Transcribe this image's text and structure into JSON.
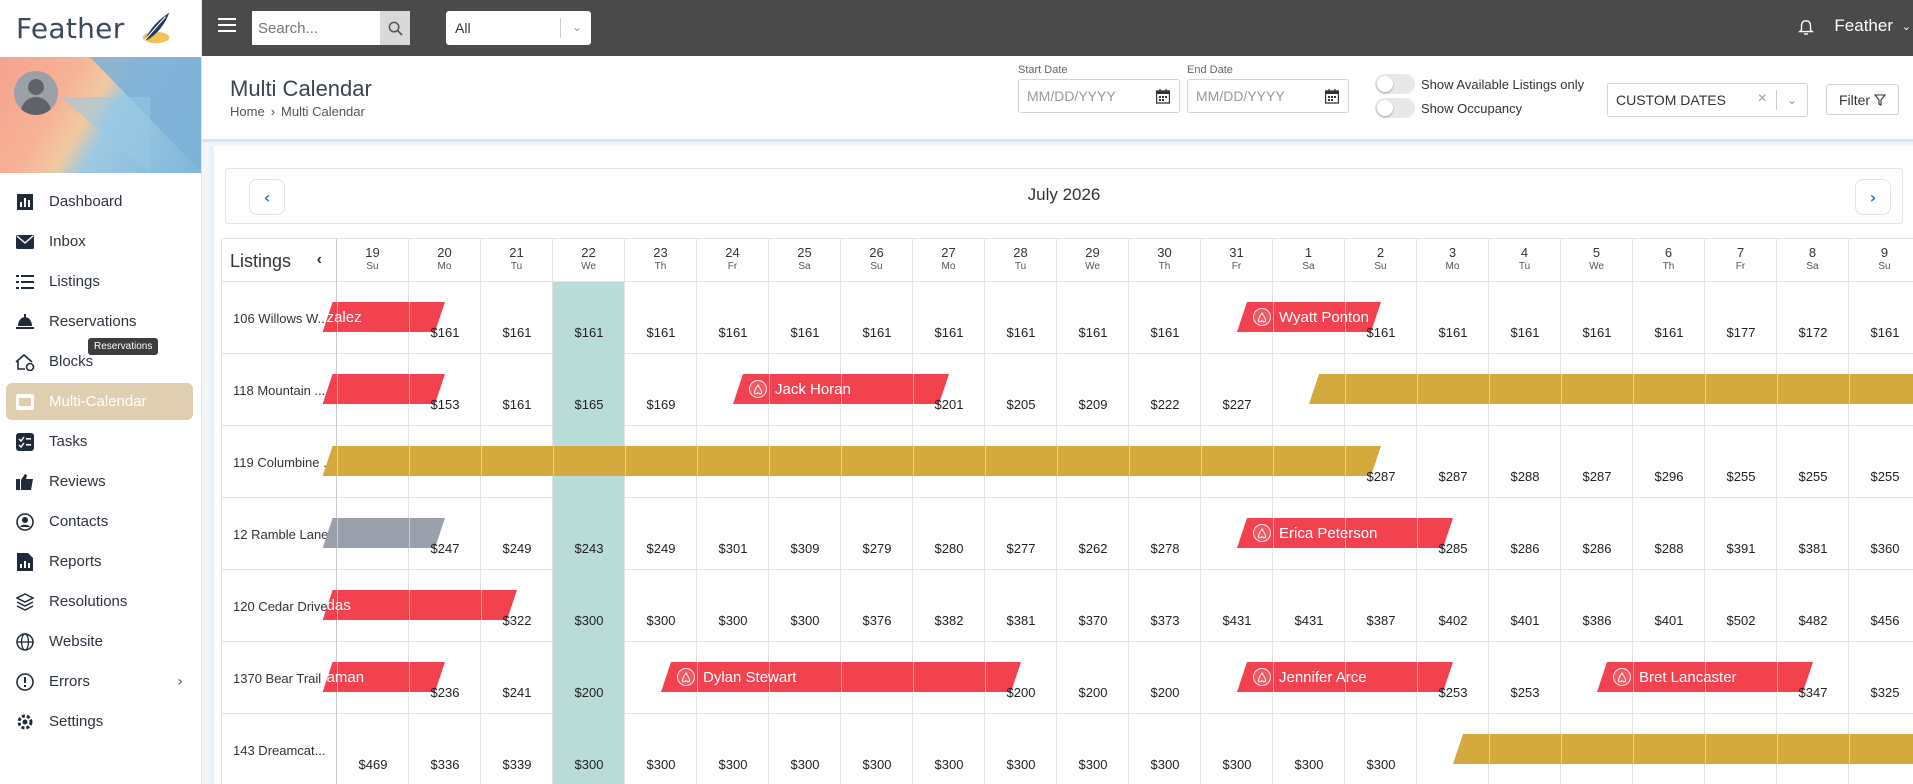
{
  "brand": {
    "name": "Feather"
  },
  "sidebar": {
    "items": [
      {
        "key": "dashboard",
        "label": "Dashboard",
        "icon": "bar-chart-icon"
      },
      {
        "key": "inbox",
        "label": "Inbox",
        "icon": "mail-icon"
      },
      {
        "key": "listings",
        "label": "Listings",
        "icon": "list-icon"
      },
      {
        "key": "reservations",
        "label": "Reservations",
        "icon": "bell-service-icon"
      },
      {
        "key": "blocks",
        "label": "Blocks",
        "icon": "home-lock-icon"
      },
      {
        "key": "multi-calendar",
        "label": "Multi-Calendar",
        "icon": "calendar-icon",
        "active": true
      },
      {
        "key": "tasks",
        "label": "Tasks",
        "icon": "checklist-icon"
      },
      {
        "key": "reviews",
        "label": "Reviews",
        "icon": "reviews-icon"
      },
      {
        "key": "contacts",
        "label": "Contacts",
        "icon": "contact-icon"
      },
      {
        "key": "reports",
        "label": "Reports",
        "icon": "report-icon"
      },
      {
        "key": "resolutions",
        "label": "Resolutions",
        "icon": "layers-icon"
      },
      {
        "key": "website",
        "label": "Website",
        "icon": "globe-icon"
      },
      {
        "key": "errors",
        "label": "Errors",
        "icon": "alert-circle-icon",
        "has_chevron": true
      },
      {
        "key": "settings",
        "label": "Settings",
        "icon": "gear-icon"
      }
    ],
    "tooltip": "Reservations"
  },
  "topbar": {
    "search_placeholder": "Search...",
    "filter_value": "All",
    "user_name": "Feather"
  },
  "header": {
    "title": "Multi Calendar",
    "breadcrumb": [
      "Home",
      "Multi Calendar"
    ],
    "start_date_label": "Start Date",
    "end_date_label": "End Date",
    "date_placeholder": "MM/DD/YYYY",
    "toggle_available": "Show Available Listings only",
    "toggle_occupancy": "Show Occupancy",
    "date_range_value": "CUSTOM DATES",
    "filter_label": "Filter"
  },
  "calendar": {
    "month_label": "July 2026",
    "listings_label": "Listings",
    "days": [
      {
        "num": "19",
        "dow": "Su"
      },
      {
        "num": "20",
        "dow": "Mo"
      },
      {
        "num": "21",
        "dow": "Tu"
      },
      {
        "num": "22",
        "dow": "We",
        "today": true
      },
      {
        "num": "23",
        "dow": "Th"
      },
      {
        "num": "24",
        "dow": "Fr"
      },
      {
        "num": "25",
        "dow": "Sa"
      },
      {
        "num": "26",
        "dow": "Su"
      },
      {
        "num": "27",
        "dow": "Mo"
      },
      {
        "num": "28",
        "dow": "Tu"
      },
      {
        "num": "29",
        "dow": "We"
      },
      {
        "num": "30",
        "dow": "Th"
      },
      {
        "num": "31",
        "dow": "Fr"
      },
      {
        "num": "1",
        "dow": "Sa"
      },
      {
        "num": "2",
        "dow": "Su"
      },
      {
        "num": "3",
        "dow": "Mo"
      },
      {
        "num": "4",
        "dow": "Tu"
      },
      {
        "num": "5",
        "dow": "We"
      },
      {
        "num": "6",
        "dow": "Th"
      },
      {
        "num": "7",
        "dow": "Fr"
      },
      {
        "num": "8",
        "dow": "Sa"
      },
      {
        "num": "9",
        "dow": "Su"
      }
    ],
    "colors": {
      "booking": "#f2424f",
      "owner_block": "#d4a93e",
      "blocked": "#9aa0ab",
      "today": "#b9dcd9"
    },
    "rows": [
      {
        "name": "106 Willows W...",
        "prices": [
          "",
          "$161",
          "$161",
          "$161",
          "$161",
          "$161",
          "$161",
          "$161",
          "$161",
          "$161",
          "$161",
          "$161",
          "",
          "",
          "$161",
          "$161",
          "$161",
          "$161",
          "$161",
          "$177",
          "$172",
          "$161"
        ],
        "bars": [
          {
            "start": -0.2,
            "end": 1.5,
            "color": "booking",
            "label": "zalez",
            "icon": false
          },
          {
            "start": 12.5,
            "end": 14.5,
            "color": "booking",
            "label": "Wyatt Ponton",
            "icon": true
          }
        ]
      },
      {
        "name": "118 Mountain ...",
        "prices": [
          "",
          "$153",
          "$161",
          "$165",
          "$169",
          "",
          "",
          "",
          "$201",
          "$205",
          "$209",
          "$222",
          "$227",
          "",
          "",
          "",
          "",
          "",
          "",
          "",
          "",
          ""
        ],
        "bars": [
          {
            "start": -0.2,
            "end": 1.5,
            "color": "booking",
            "label": "",
            "icon": false
          },
          {
            "start": 5.5,
            "end": 8.5,
            "color": "booking",
            "label": "Jack Horan",
            "icon": true
          },
          {
            "start": 13.5,
            "end": 22.5,
            "color": "owner_block",
            "label": "",
            "icon": false
          }
        ]
      },
      {
        "name": "119 Columbine ...",
        "prices": [
          "",
          "",
          "",
          "",
          "",
          "",
          "",
          "",
          "",
          "",
          "",
          "",
          "",
          "",
          "$287",
          "$287",
          "$288",
          "$287",
          "$296",
          "$255",
          "$255",
          "$255"
        ],
        "bars": [
          {
            "start": -0.2,
            "end": 14.5,
            "color": "owner_block",
            "label": "",
            "icon": false
          }
        ]
      },
      {
        "name": "12 Ramble Lane",
        "prices": [
          "",
          "$247",
          "$249",
          "$243",
          "$249",
          "$301",
          "$309",
          "$279",
          "$280",
          "$277",
          "$262",
          "$278",
          "",
          "",
          "",
          "$285",
          "$286",
          "$286",
          "$288",
          "$391",
          "$381",
          "$360"
        ],
        "bars": [
          {
            "start": -0.2,
            "end": 1.5,
            "color": "blocked",
            "label": "",
            "icon": false
          },
          {
            "start": 12.5,
            "end": 15.5,
            "color": "booking",
            "label": "Erica Peterson",
            "icon": true
          }
        ]
      },
      {
        "name": "120 Cedar Drive",
        "prices": [
          "",
          "",
          "$322",
          "$300",
          "$300",
          "$300",
          "$300",
          "$376",
          "$382",
          "$381",
          "$370",
          "$373",
          "$431",
          "$431",
          "$387",
          "$402",
          "$401",
          "$386",
          "$401",
          "$502",
          "$482",
          "$456"
        ],
        "bars": [
          {
            "start": -0.2,
            "end": 2.5,
            "color": "booking",
            "label": "das",
            "icon": false
          }
        ]
      },
      {
        "name": "1370 Bear Trail",
        "prices": [
          "",
          "$236",
          "$241",
          "$200",
          "",
          "",
          "",
          "",
          "",
          "$200",
          "$200",
          "$200",
          "",
          "",
          "",
          "$253",
          "$253",
          "",
          "",
          "",
          "$347",
          "$325"
        ],
        "bars": [
          {
            "start": -0.2,
            "end": 1.5,
            "color": "booking",
            "label": "aman",
            "icon": false
          },
          {
            "start": 4.5,
            "end": 9.5,
            "color": "booking",
            "label": "Dylan Stewart",
            "icon": true
          },
          {
            "start": 12.5,
            "end": 15.5,
            "color": "booking",
            "label": "Jennifer Arce",
            "icon": true
          },
          {
            "start": 17.5,
            "end": 20.5,
            "color": "booking",
            "label": "Bret Lancaster",
            "icon": true
          }
        ]
      },
      {
        "name": "143 Dreamcat...",
        "prices": [
          "$469",
          "$336",
          "$339",
          "$300",
          "$300",
          "$300",
          "$300",
          "$300",
          "$300",
          "$300",
          "$300",
          "$300",
          "$300",
          "$300",
          "$300",
          "",
          "",
          "",
          "",
          "",
          "",
          ""
        ],
        "bars": [
          {
            "start": 15.5,
            "end": 22.5,
            "color": "owner_block",
            "label": "",
            "icon": false
          }
        ]
      }
    ]
  }
}
